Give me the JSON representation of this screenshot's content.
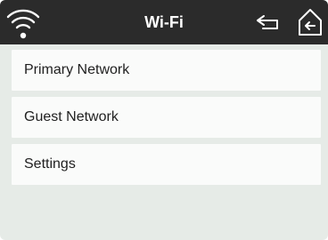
{
  "header": {
    "title": "Wi-Fi",
    "left_icon": "wifi-icon",
    "back_icon": "back-arrow-icon",
    "home_icon": "home-back-icon"
  },
  "menu": {
    "items": [
      {
        "label": "Primary Network"
      },
      {
        "label": "Guest Network"
      },
      {
        "label": "Settings"
      }
    ]
  },
  "colors": {
    "header_bg": "#2b2b2b",
    "screen_bg": "#e6ebe7",
    "item_bg": "#fafbfa",
    "header_text": "#ffffff",
    "item_text": "#1f1f1f"
  }
}
